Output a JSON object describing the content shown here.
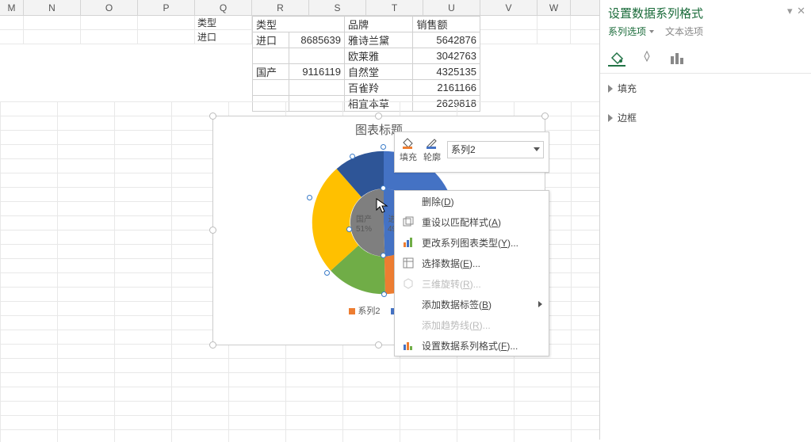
{
  "columns": [
    "M",
    "N",
    "O",
    "P",
    "Q",
    "R",
    "S",
    "T",
    "U",
    "V",
    "W"
  ],
  "table": {
    "headers": {
      "type": "类型",
      "brand": "品牌",
      "sales": "销售额"
    },
    "rows": [
      {
        "type": "进口",
        "type_total": 8685639,
        "brand": "雅诗兰黛",
        "sales": 5642876
      },
      {
        "type": "",
        "type_total": "",
        "brand": "欧莱雅",
        "sales": 3042763
      },
      {
        "type": "国产",
        "type_total": 9116119,
        "brand": "自然堂",
        "sales": 4325135
      },
      {
        "type": "",
        "type_total": "",
        "brand": "百雀羚",
        "sales": 2161166
      },
      {
        "type": "",
        "type_total": "",
        "brand": "相宜本草",
        "sales": 2629818
      }
    ]
  },
  "chart": {
    "title": "图表标题"
  },
  "chart_data": {
    "type": "pie",
    "title": "图表标题",
    "series": [
      {
        "name": "系列1",
        "categories": [
          "国产",
          "进口"
        ],
        "values": [
          51,
          49
        ],
        "colors": [
          "#7f7f7f",
          "#4472c4"
        ],
        "labels": [
          "国产\n51%",
          "进口\n49%"
        ],
        "data_labels": true
      },
      {
        "name": "系列2",
        "categories": [
          "雅诗兰黛",
          "欧莱雅",
          "自然堂",
          "百雀羚",
          "相宜本草"
        ],
        "values": [
          5642876,
          3042763,
          4325135,
          2161166,
          2629818
        ],
        "colors": [
          "#4472c4",
          "#5b9bd5",
          "#ffc000",
          "#70ad47",
          "#ed7d31"
        ]
      }
    ],
    "legend": [
      "系列2",
      "系列1"
    ],
    "selected_series": "系列2"
  },
  "legend": {
    "s2": "系列2",
    "s1": "系列"
  },
  "legend_colors": {
    "s2": "#ed7d31",
    "s1": "#4472c4"
  },
  "mini": {
    "fill": "填充",
    "outline": "轮廓",
    "series": "系列2"
  },
  "ctx": {
    "delete": "删除(",
    "delete_u": "D",
    "delete_end": ")",
    "reset": "重设以匹配样式(",
    "reset_u": "A",
    "reset_end": ")",
    "change": "更改系列图表类型(",
    "change_u": "Y",
    "change_end": ")...",
    "select": "选择数据(",
    "select_u": "E",
    "select_end": ")...",
    "rotate": "三维旋转(",
    "rotate_u": "R",
    "rotate_end": ")...",
    "labels": "添加数据标签(",
    "labels_u": "B",
    "labels_end": ")",
    "trend": "添加趋势线(",
    "trend_u": "R",
    "trend_end": ")...",
    "format": "设置数据系列格式(",
    "format_u": "F",
    "format_end": ")..."
  },
  "pane": {
    "title": "设置数据系列格式",
    "tab1": "系列选项",
    "tab2": "文本选项",
    "sec_fill": "填充",
    "sec_border": "边框"
  },
  "pie_labels": {
    "gc": "国产",
    "gc_pct": "51%",
    "jk": "进",
    "jk_pct": "49"
  }
}
